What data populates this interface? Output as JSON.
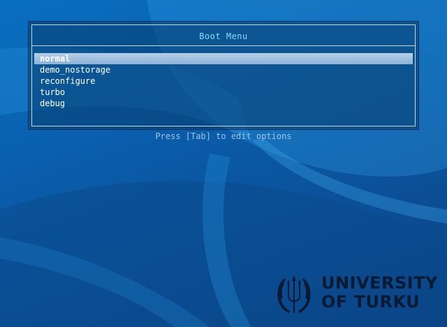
{
  "menu": {
    "title": "Boot Menu",
    "items": [
      {
        "label": "normal",
        "selected": true
      },
      {
        "label": "demo_nostorage",
        "selected": false
      },
      {
        "label": "reconfigure",
        "selected": false
      },
      {
        "label": "turbo",
        "selected": false
      },
      {
        "label": "debug",
        "selected": false
      }
    ]
  },
  "hint": "Press [Tab] to edit options",
  "logo": {
    "line1": "UNIVERSITY",
    "line2": "OF TURKU",
    "emblem_icon": "trident-wings-emblem"
  },
  "colors": {
    "background": "#0a5fae",
    "title": "#8ed6ff",
    "selection": "#9fbfe0",
    "hint": "#9fc6e6",
    "logo": "#0a1a33"
  }
}
